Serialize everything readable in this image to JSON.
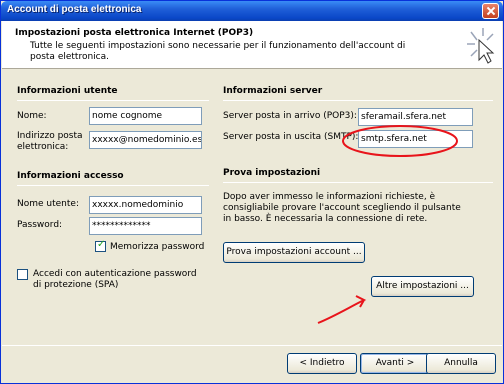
{
  "window": {
    "title": "Account di posta elettronica"
  },
  "header": {
    "title": "Impostazioni posta elettronica Internet (POP3)",
    "subtitle": "Tutte le seguenti impostazioni sono necessarie per il funzionamento dell'account di posta elettronica."
  },
  "user_info": {
    "title": "Informazioni utente",
    "name_label": "Nome:",
    "name_value": "nome cognome",
    "email_label": "Indirizzo posta elettronica:",
    "email_value": "xxxxx@nomedominio.est"
  },
  "access_info": {
    "title": "Informazioni accesso",
    "username_label": "Nome utente:",
    "username_value": "xxxxx.nomedominio",
    "password_label": "Password:",
    "password_value": "*************",
    "remember_label": "Memorizza password",
    "spa_label": "Accedi con autenticazione password di protezione (SPA)"
  },
  "server_info": {
    "title": "Informazioni server",
    "incoming_label": "Server posta in arrivo (POP3):",
    "incoming_value": "sferamail.sfera.net",
    "outgoing_label": "Server posta in uscita (SMTP):",
    "outgoing_value": "smtp.sfera.net"
  },
  "test": {
    "title": "Prova impostazioni",
    "description": "Dopo aver immesso le informazioni richieste, è consigliabile provare l'account scegliendo il pulsante in basso. È necessaria la connessione di rete.",
    "test_button": "Prova impostazioni account ..."
  },
  "more_settings_button": "Altre impostazioni ...",
  "footer": {
    "back": "< Indietro",
    "next": "Avanti >",
    "cancel": "Annulla"
  },
  "colors": {
    "annotation": "#e8141b",
    "title_bar": "#0a47c8"
  }
}
